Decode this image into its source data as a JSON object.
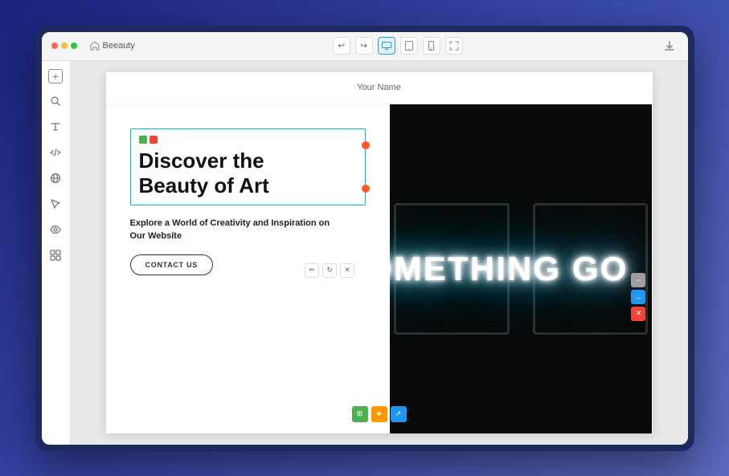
{
  "browser": {
    "title": "Beeauty",
    "controls": [
      "undo",
      "redo",
      "desktop",
      "tablet",
      "mobile",
      "fullscreen"
    ],
    "download_icon": "↓"
  },
  "sidebar": {
    "icons": [
      "plus",
      "search",
      "typography",
      "code",
      "globe",
      "cursor",
      "eye",
      "grid"
    ]
  },
  "preview": {
    "brand_name": "Your Name",
    "hero": {
      "title_line1": "Discover the",
      "title_line2": "Beauty of Art",
      "subtitle": "Explore a World of Creativity and Inspiration on Our Website",
      "cta_button": "CONTACT US"
    },
    "neon_text": "OMETHING GO"
  },
  "image_tools": [
    "pencil",
    "refresh",
    "close"
  ],
  "right_tools": [
    "minus",
    "arrow",
    "close"
  ],
  "bottom_tools": [
    "grid",
    "star",
    "arrow"
  ]
}
